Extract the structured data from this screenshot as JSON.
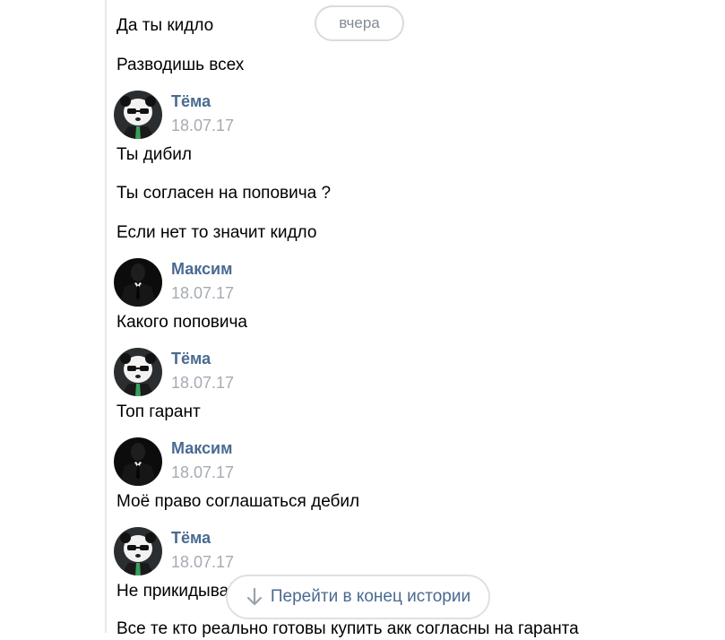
{
  "date_pill": "вчера",
  "messages": [
    {
      "type": "text",
      "text": "Да ты кидло"
    },
    {
      "type": "text",
      "text": "Разводишь всех"
    },
    {
      "type": "author",
      "name": "Тёма",
      "date": "18.07.17",
      "avatar": "panda-avatar"
    },
    {
      "type": "text",
      "text": "Ты дибил"
    },
    {
      "type": "text",
      "text": "Ты согласен на поповича ?"
    },
    {
      "type": "text",
      "text": "Если нет то значит кидло"
    },
    {
      "type": "author",
      "name": "Максим",
      "date": "18.07.17",
      "avatar": "suit-avatar"
    },
    {
      "type": "text",
      "text": "Какого поповича"
    },
    {
      "type": "author",
      "name": "Тёма",
      "date": "18.07.17",
      "avatar": "panda-avatar"
    },
    {
      "type": "text",
      "text": "Топ гарант"
    },
    {
      "type": "author",
      "name": "Максим",
      "date": "18.07.17",
      "avatar": "suit-avatar"
    },
    {
      "type": "text",
      "text": "Моё право соглашаться дебил"
    },
    {
      "type": "author",
      "name": "Тёма",
      "date": "18.07.17",
      "avatar": "panda-avatar"
    },
    {
      "type": "text",
      "text": "Не прикидывайся"
    },
    {
      "type": "text",
      "text": "Все те кто реально готовы купить акк согласны на гаранта"
    }
  ],
  "jump_button": {
    "label": "Перейти в конец истории",
    "icon": "arrow-down-icon"
  },
  "colors": {
    "author": "#4a6a92",
    "date": "#a5abb3",
    "accent": "#4a6a92",
    "border": "#e7e8ec"
  }
}
